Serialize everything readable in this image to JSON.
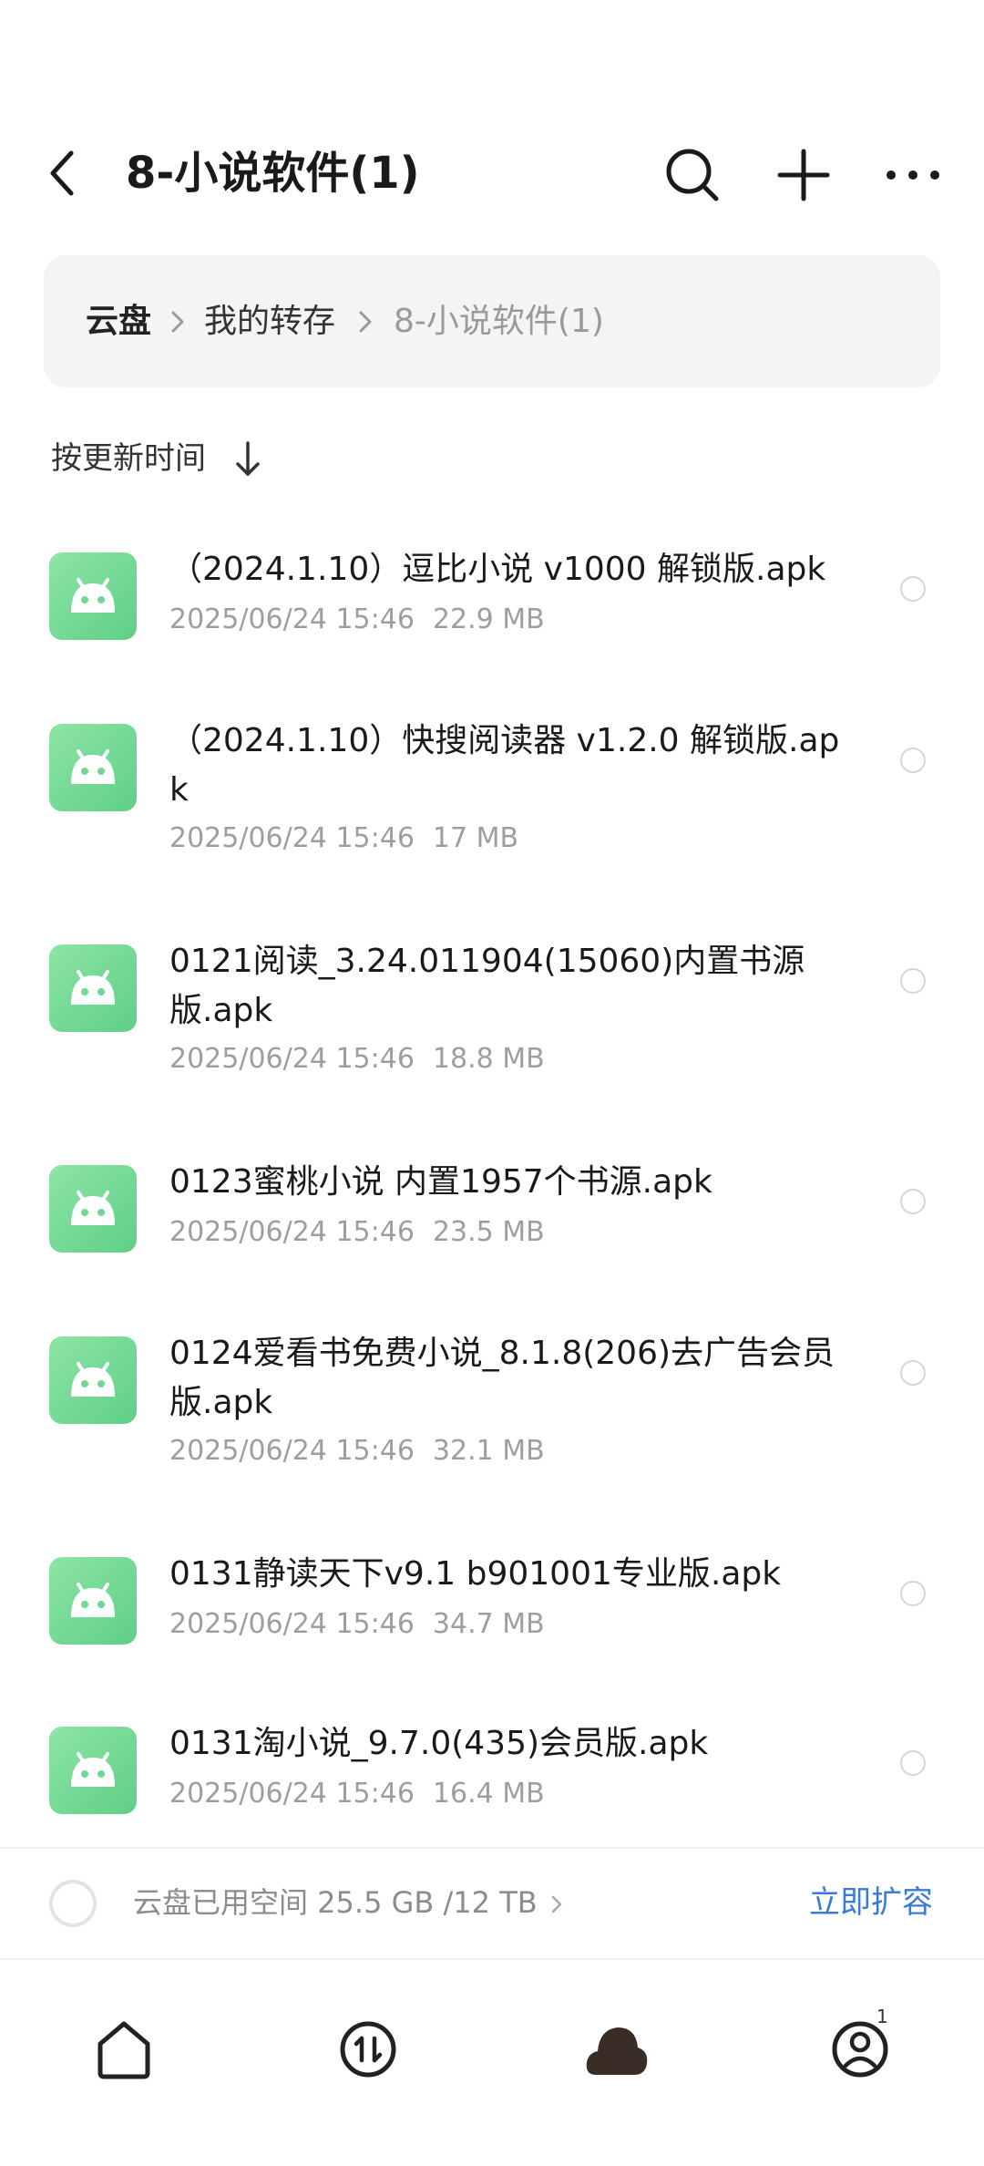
{
  "header": {
    "title": "8-小说软件(1)",
    "back_icon": "back-arrow-icon",
    "search_icon": "search-icon",
    "add_icon": "plus-icon",
    "more_icon": "more-icon"
  },
  "breadcrumb": {
    "items": [
      "云盘",
      "我的转存",
      "8-小说软件(1)"
    ]
  },
  "sort": {
    "label": "按更新时间"
  },
  "files": [
    {
      "name": "（2024.1.10）逗比小说 v1000 解锁版.apk",
      "date": "2025/06/24 15:46",
      "size": "22.9 MB"
    },
    {
      "name": "（2024.1.10）快搜阅读器 v1.2.0 解锁版.apk",
      "date": "2025/06/24 15:46",
      "size": "17 MB"
    },
    {
      "name": "0121阅读_3.24.011904(15060)内置书源版.apk",
      "date": "2025/06/24 15:46",
      "size": "18.8 MB"
    },
    {
      "name": "0123蜜桃小说 内置1957个书源.apk",
      "date": "2025/06/24 15:46",
      "size": "23.5 MB"
    },
    {
      "name": "0124爱看书免费小说_8.1.8(206)去广告会员版.apk",
      "date": "2025/06/24 15:46",
      "size": "32.1 MB"
    },
    {
      "name": "0131静读天下v9.1 b901001专业版.apk",
      "date": "2025/06/24 15:46",
      "size": "34.7 MB"
    },
    {
      "name": "0131淘小说_9.7.0(435)会员版.apk",
      "date": "2025/06/24 15:46",
      "size": "16.4 MB"
    }
  ],
  "storage": {
    "text": "云盘已用空间 25.5 GB /12 TB",
    "expand_label": "立即扩容"
  },
  "bottom_nav": {
    "items": [
      "home-icon",
      "transfer-icon",
      "cloud-icon",
      "profile-icon"
    ],
    "profile_badge": "1"
  },
  "colors": {
    "accent": "#3a7ad9",
    "apk_green": "#6fd894",
    "muted": "#9e9e9e"
  }
}
